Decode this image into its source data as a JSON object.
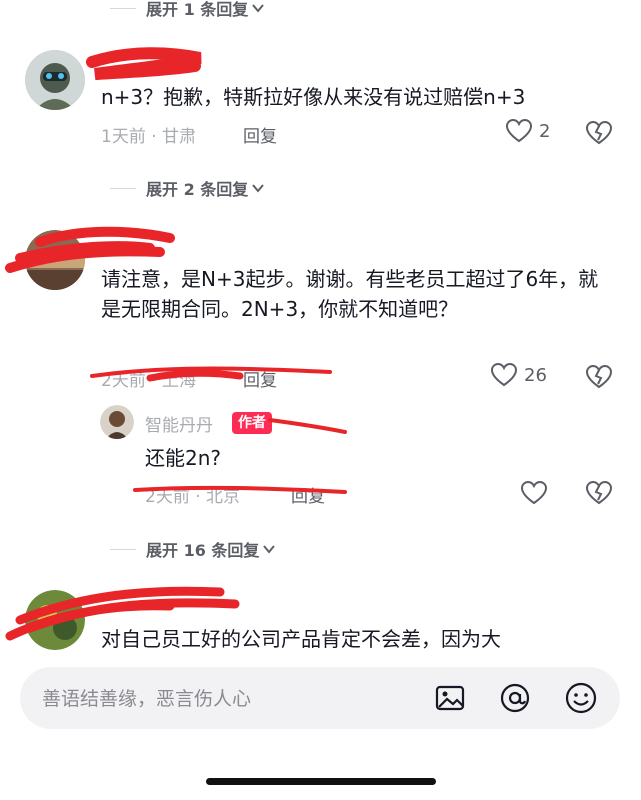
{
  "expands": {
    "e1": "展开 1 条回复",
    "e2": "展开 2 条回复",
    "e3": "展开 16 条回复"
  },
  "comments": [
    {
      "text": "n+3？抱歉，特斯拉好像从来没有说过赔偿n+3",
      "meta": "1天前 · 甘肃",
      "reply": "回复",
      "likes": "2"
    },
    {
      "text": "请注意，是N+3起步。谢谢。有些老员工超过了6年，就是无限期合同。2N+3，你就不知道吧？",
      "meta": "2天前 · 上海",
      "reply": "回复",
      "likes": "26"
    },
    {
      "username": "智能丹丹",
      "badge": "作者",
      "text": "还能2n?",
      "meta": "2天前 · 北京",
      "reply": "回复"
    },
    {
      "text": "对自己员工好的公司产品肯定不会差，因为大"
    }
  ],
  "input": {
    "placeholder": "善语结善缘，恶言伤人心"
  },
  "icons": {
    "image": "image-icon",
    "mention": "at-icon",
    "emoji": "emoji-icon"
  },
  "colors": {
    "accent": "#fe2c55",
    "scribble": "#e8262a",
    "meta": "#a9abb2"
  }
}
